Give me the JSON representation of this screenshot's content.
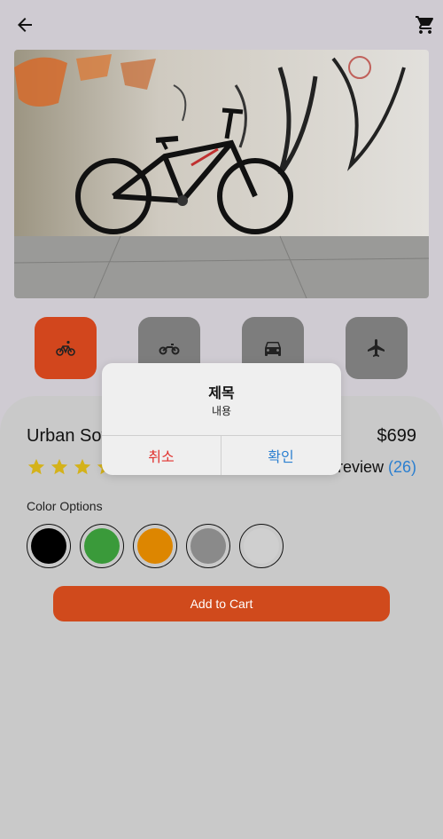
{
  "header": {
    "back_icon": "arrow-left-icon",
    "cart_icon": "shopping-cart-icon"
  },
  "hero": {
    "image": "mountain-bike-against-graffiti-wall"
  },
  "categories": [
    {
      "icon": "bicycle-icon",
      "active": true
    },
    {
      "icon": "motorcycle-icon",
      "active": false
    },
    {
      "icon": "car-icon",
      "active": false
    },
    {
      "icon": "airplane-icon",
      "active": false
    }
  ],
  "product": {
    "title": "Urban Soft",
    "price": "$699",
    "rating": 4,
    "rating_max": 5,
    "review_label": "review",
    "review_count": "(26)"
  },
  "colors": {
    "label": "Color Options",
    "options": [
      "#000000",
      "#3a9a3a",
      "#dd8600",
      "#8a8a8a",
      "#cfcfcf"
    ]
  },
  "actions": {
    "add_to_cart": "Add to Cart"
  },
  "dialog": {
    "title": "제목",
    "message": "내용",
    "cancel": "취소",
    "confirm": "확인"
  },
  "colors_theme": {
    "accent": "#d2461d",
    "link": "#2b7fd0",
    "star": "#d4b21a"
  }
}
